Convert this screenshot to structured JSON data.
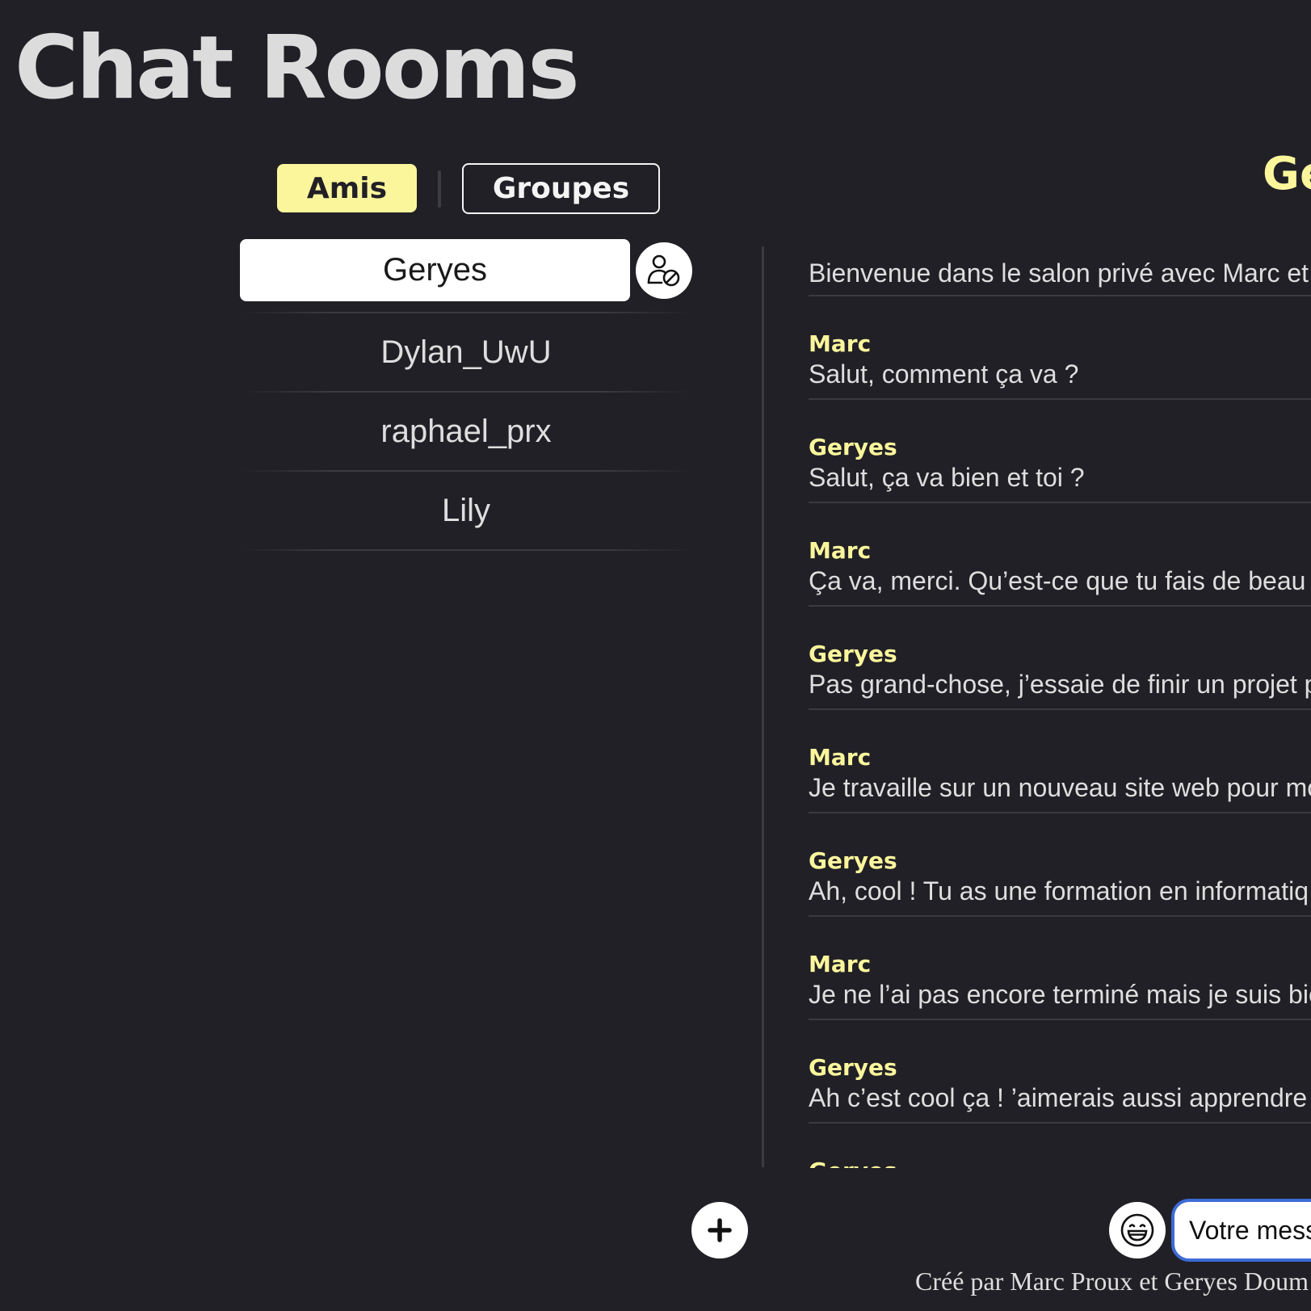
{
  "app": {
    "title": "Chat Rooms"
  },
  "tabs": {
    "friends": "Amis",
    "groups": "Groupes"
  },
  "contacts": {
    "active": "Geryes",
    "items": [
      "Dylan_UwU",
      "raphael_prx",
      "Lily"
    ]
  },
  "conversation": {
    "title": "Ge",
    "welcome": "Bienvenue dans le salon privé avec Marc et",
    "messages": [
      {
        "author": "Marc",
        "text": "Salut, comment ça va ?"
      },
      {
        "author": "Geryes",
        "text": "Salut, ça va bien et toi ?"
      },
      {
        "author": "Marc",
        "text": "Ça va, merci. Qu’est-ce que tu fais de beau"
      },
      {
        "author": "Geryes",
        "text": "Pas grand-chose, j’essaie de finir un projet p"
      },
      {
        "author": "Marc",
        "text": "Je travaille sur un nouveau site web pour mo"
      },
      {
        "author": "Geryes",
        "text": "Ah, cool ! Tu as une formation en informatiq"
      },
      {
        "author": "Marc",
        "text": "Je ne l’ai pas encore terminé mais je suis bie"
      },
      {
        "author": "Geryes",
        "text": "Ah c’est cool ça ! ’aimerais aussi apprendre"
      },
      {
        "author": "Geryes",
        "text": ""
      }
    ]
  },
  "composer": {
    "placeholder": "Votre message"
  },
  "footer": {
    "credit": "Créé par Marc Proux et Geryes Doum"
  },
  "colors": {
    "background": "#212026",
    "accent": "#fbf69c",
    "input_border": "#3d6bd6"
  },
  "icons": {
    "block": "user-block-icon",
    "add": "plus-icon",
    "emoji": "emoji-icon"
  }
}
